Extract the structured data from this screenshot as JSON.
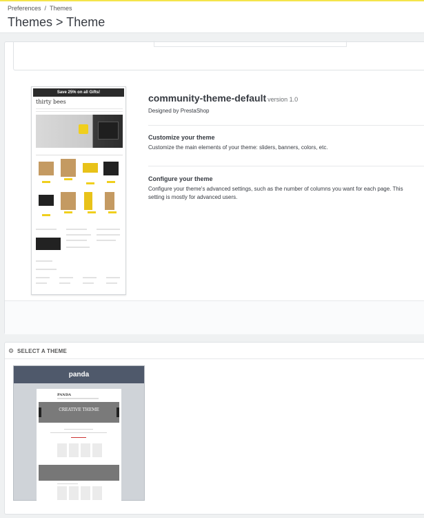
{
  "breadcrumb": {
    "parent": "Preferences",
    "separator": "/",
    "current": "Themes"
  },
  "page_title": "Themes > Theme",
  "current_theme": {
    "name": "community-theme-default",
    "version": "version 1.0",
    "designer": "Designed by PrestaShop",
    "thumbnail": {
      "banner": "Save 25% on all Gifts!",
      "brand": "thirty bees"
    },
    "sections": [
      {
        "title": "Customize your theme",
        "description": "Customize the main elements of your theme: sliders, banners, colors, etc."
      },
      {
        "title": "Configure your theme",
        "description": "Configure your theme's advanced settings, such as the number of columns you want for each page. This setting is mostly for advanced users."
      }
    ]
  },
  "select_theme": {
    "heading": "SELECT A THEME",
    "heading_icon": "gears-icon",
    "themes": [
      {
        "name": "panda",
        "preview": {
          "brand": "PANDA",
          "hero_text": "CREATIVE THEME"
        }
      }
    ]
  },
  "colors": {
    "accent_top": "#f5e44a",
    "card_header": "#4f596b",
    "card_body": "#cfd3d8"
  }
}
